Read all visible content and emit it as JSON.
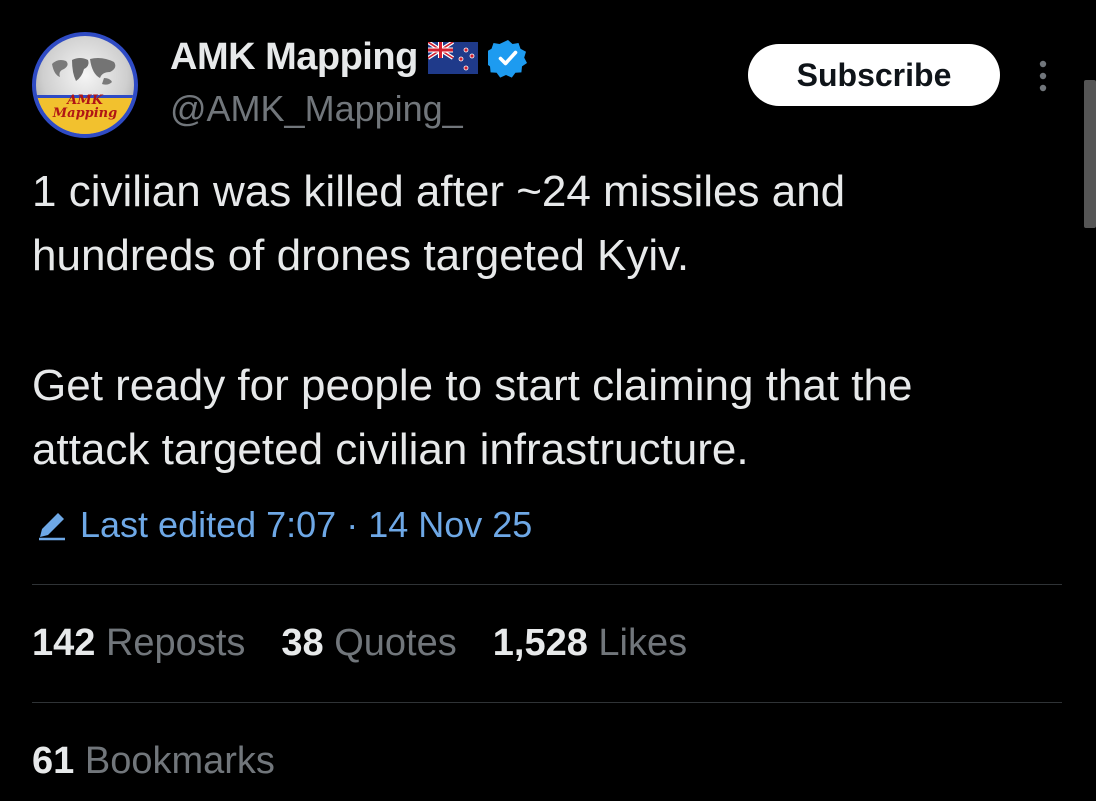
{
  "author": {
    "display_name": "AMK Mapping",
    "handle": "@AMK_Mapping_",
    "avatar_text": "AMK Mapping",
    "flag_icon": "new-zealand-flag-icon",
    "verified_icon": "verified-badge-icon"
  },
  "actions": {
    "subscribe_label": "Subscribe",
    "more_icon": "more-options-icon"
  },
  "tweet": {
    "paragraphs": [
      "1 civilian was killed after ~24 missiles and hundreds of drones targeted Kyiv.",
      "Get ready for people to start claiming that the attack targeted civilian infrastructure."
    ],
    "edited_text": "Last edited 7:07 · 14 Nov 25"
  },
  "stats": {
    "reposts": {
      "count": "142",
      "label": "Reposts"
    },
    "quotes": {
      "count": "38",
      "label": "Quotes"
    },
    "likes": {
      "count": "1,528",
      "label": "Likes"
    },
    "bookmarks": {
      "count": "61",
      "label": "Bookmarks"
    }
  },
  "colors": {
    "background": "#000000",
    "text": "#e7e9ea",
    "muted": "#71767b",
    "link": "#6ea8e6",
    "verified": "#1d9bf0"
  }
}
